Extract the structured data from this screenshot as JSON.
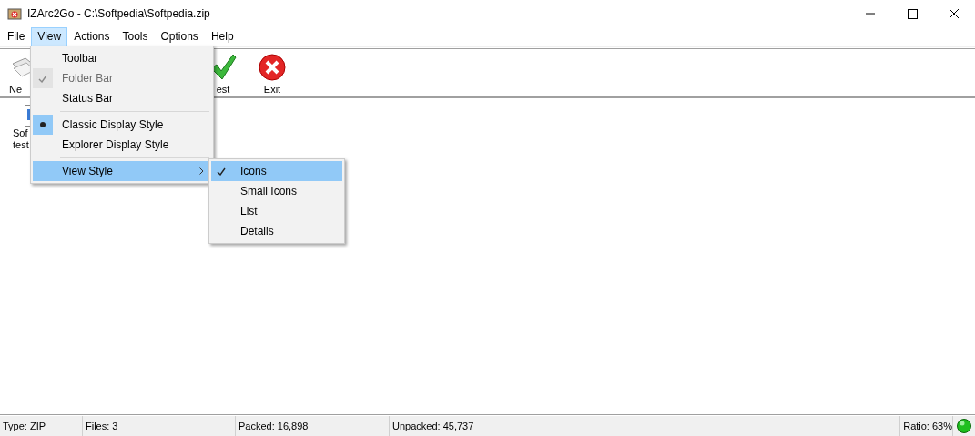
{
  "window": {
    "title": "IZArc2Go - C:\\Softpedia\\Softpedia.zip"
  },
  "menubar": [
    {
      "label": "File",
      "selected": false
    },
    {
      "label": "View",
      "selected": true
    },
    {
      "label": "Actions",
      "selected": false
    },
    {
      "label": "Tools",
      "selected": false
    },
    {
      "label": "Options",
      "selected": false
    },
    {
      "label": "Help",
      "selected": false
    }
  ],
  "toolbar": [
    {
      "kind": "new",
      "label": "Ne"
    },
    {
      "kind": "test",
      "label": "est"
    },
    {
      "kind": "exit",
      "label": "Exit"
    }
  ],
  "files": [
    {
      "lines": [
        "Sof",
        "test"
      ]
    }
  ],
  "view_menu": [
    {
      "kind": "check",
      "label": "Toolbar",
      "checked": false,
      "disabled": false,
      "selected": false
    },
    {
      "kind": "check",
      "label": "Folder Bar",
      "checked": true,
      "disabled": true,
      "selected": false
    },
    {
      "kind": "check",
      "label": "Status Bar",
      "checked": false,
      "disabled": false,
      "selected": false
    },
    {
      "kind": "separator"
    },
    {
      "kind": "radio",
      "label": "Classic Display Style",
      "checked": true,
      "disabled": false,
      "selected": false
    },
    {
      "kind": "radio",
      "label": "Explorer Display Style",
      "checked": false,
      "disabled": false,
      "selected": false
    },
    {
      "kind": "separator"
    },
    {
      "kind": "submenu",
      "label": "View Style",
      "checked": false,
      "disabled": false,
      "selected": true
    }
  ],
  "view_style_menu": [
    {
      "kind": "radio",
      "label": "Icons",
      "checked": true,
      "disabled": false,
      "selected": true
    },
    {
      "kind": "radio",
      "label": "Small Icons",
      "checked": false,
      "disabled": false,
      "selected": false
    },
    {
      "kind": "radio",
      "label": "List",
      "checked": false,
      "disabled": false,
      "selected": false
    },
    {
      "kind": "radio",
      "label": "Details",
      "checked": false,
      "disabled": false,
      "selected": false
    }
  ],
  "status_bar": [
    "Type: ZIP",
    "Files: 3",
    "Packed: 16,898",
    "Unpacked: 45,737",
    "Ratio: 63%"
  ]
}
